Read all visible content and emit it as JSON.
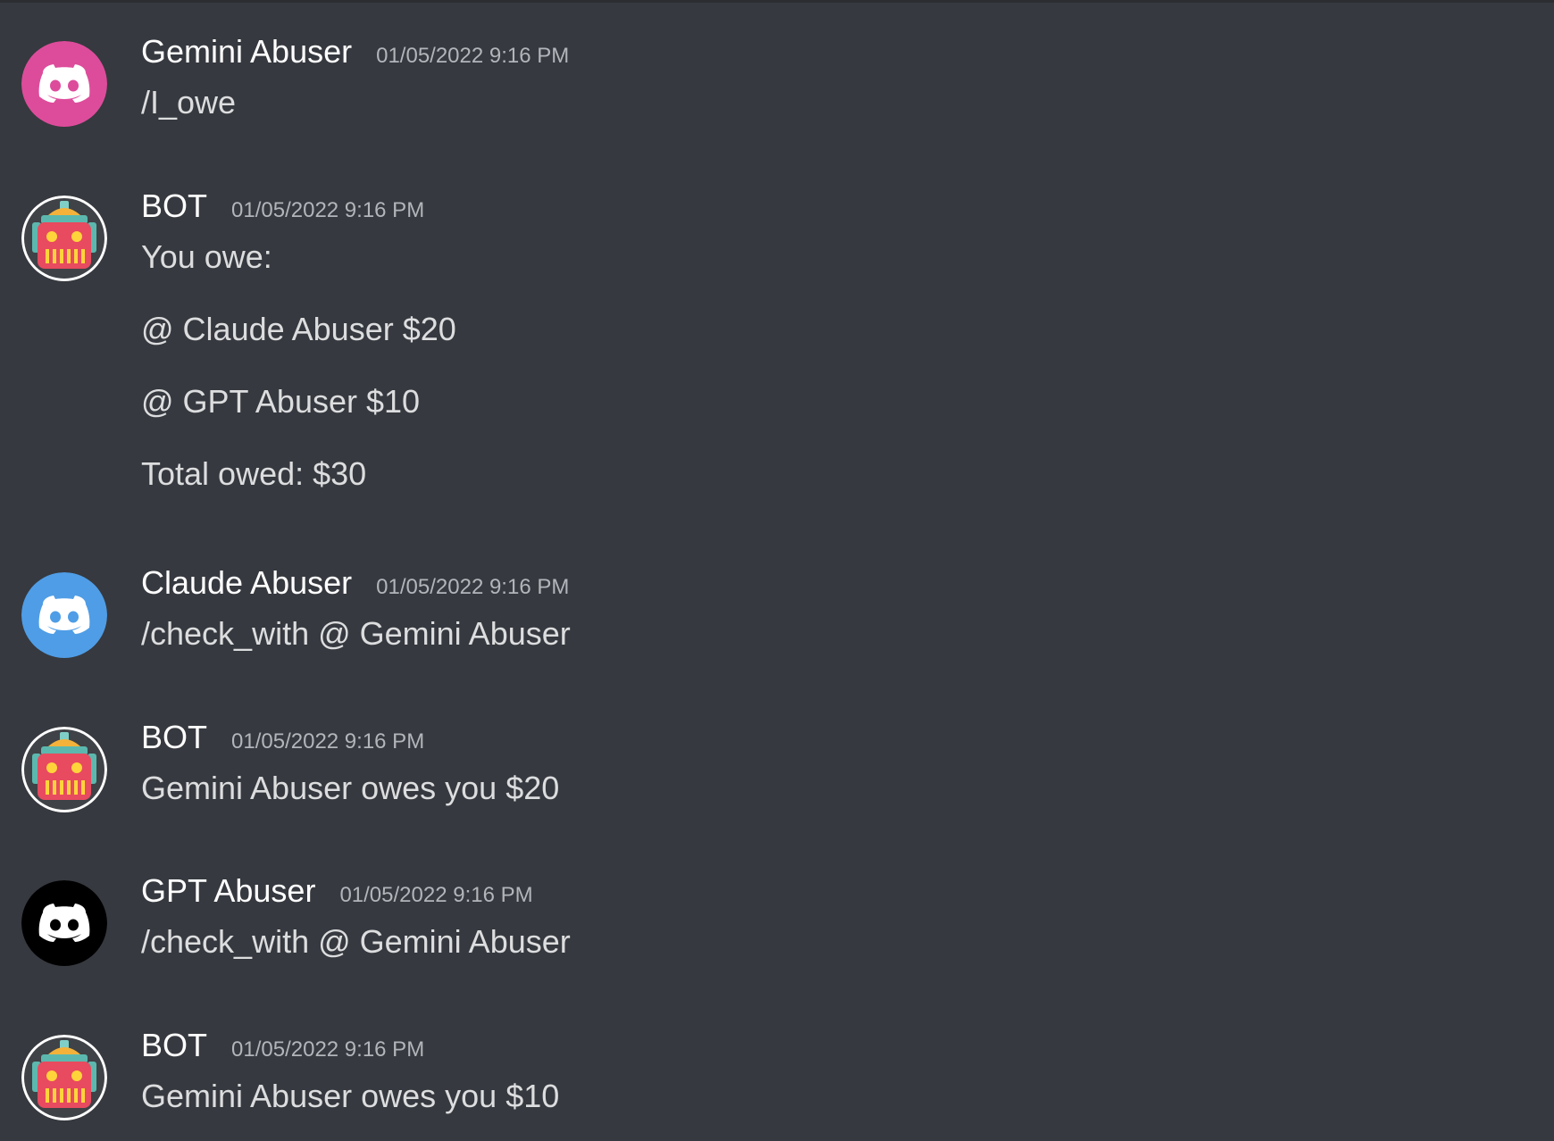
{
  "channel": {
    "messages": [
      {
        "author": "Gemini Abuser",
        "timestamp": "01/05/2022 9:16 PM",
        "avatar_icon": "discord-logo-icon",
        "avatar_color": "#dd4c9b",
        "lines": [
          "/I_owe"
        ]
      },
      {
        "author": "BOT",
        "timestamp": "01/05/2022 9:16 PM",
        "avatar_icon": "robot-icon",
        "avatar_color": "#e84a5f",
        "lines": [
          "You owe:",
          "@ Claude Abuser $20",
          "@ GPT Abuser $10",
          "Total owed: $30"
        ]
      },
      {
        "author": "Claude Abuser",
        "timestamp": "01/05/2022 9:16 PM",
        "avatar_icon": "discord-logo-icon",
        "avatar_color": "#4f9de6",
        "lines": [
          "/check_with @ Gemini Abuser"
        ]
      },
      {
        "author": "BOT",
        "timestamp": "01/05/2022 9:16 PM",
        "avatar_icon": "robot-icon",
        "avatar_color": "#e84a5f",
        "lines": [
          "Gemini Abuser owes you $20"
        ]
      },
      {
        "author": "GPT Abuser",
        "timestamp": "01/05/2022 9:16 PM",
        "avatar_icon": "discord-logo-icon",
        "avatar_color": "#000000",
        "lines": [
          "/check_with @ Gemini Abuser"
        ]
      },
      {
        "author": "BOT",
        "timestamp": "01/05/2022 9:16 PM",
        "avatar_icon": "robot-icon",
        "avatar_color": "#e84a5f",
        "lines": [
          "Gemini Abuser owes you $10"
        ]
      }
    ]
  },
  "theme": {
    "background": "#36393f",
    "username_color": "#ffffff",
    "timestamp_color": "#b2b5ba",
    "text_color": "#dcddde"
  }
}
